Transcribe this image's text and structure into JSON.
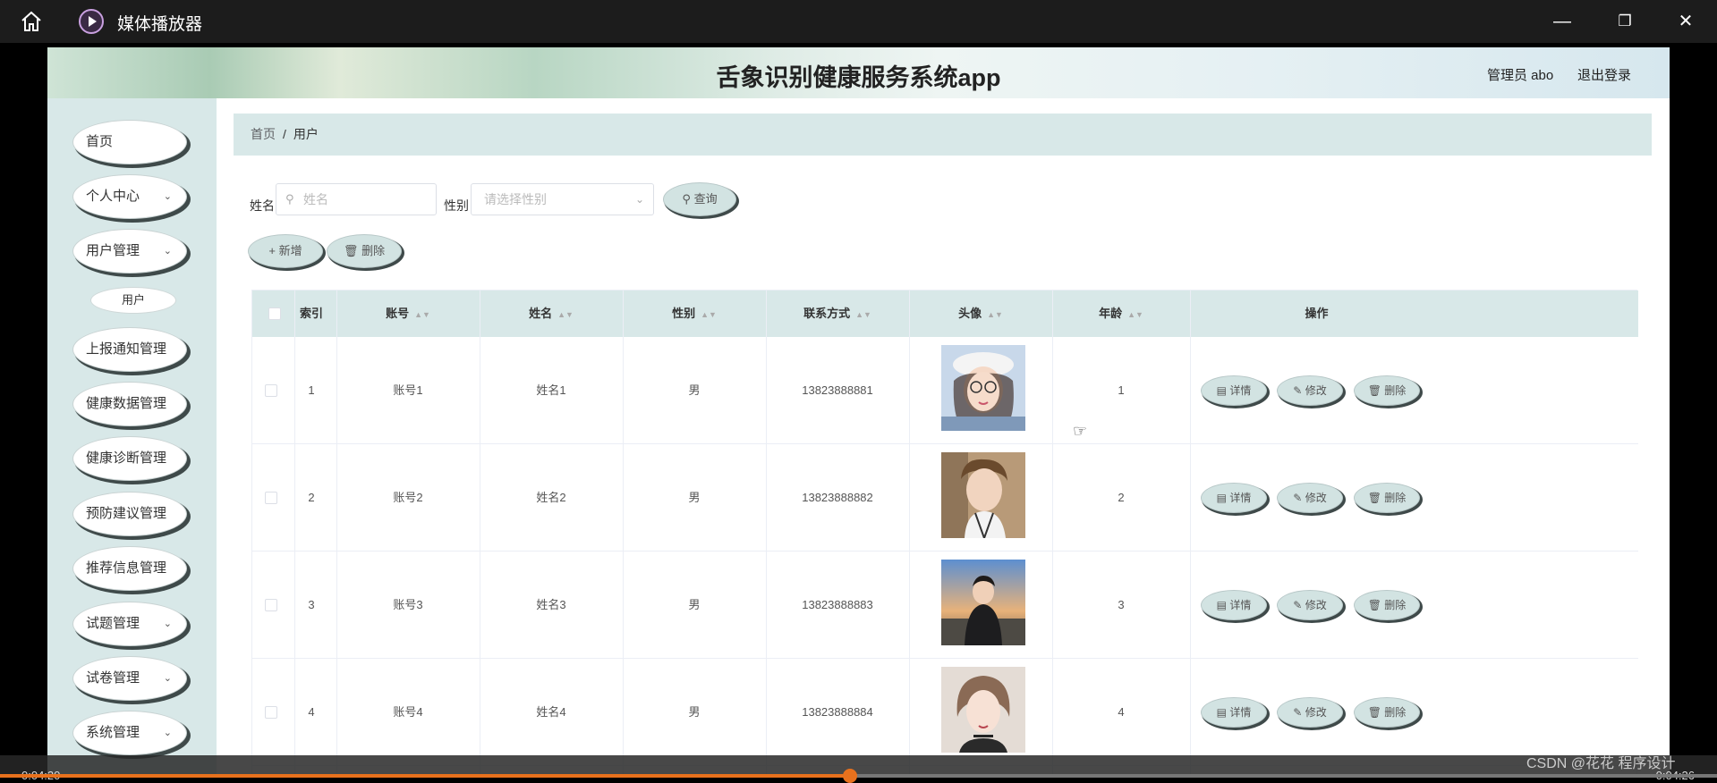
{
  "player": {
    "app_title": "媒体播放器",
    "time_elapsed": "0:04:20",
    "time_remaining": "0:04:26",
    "progress_fraction": 0.495,
    "accent_color": "#e8711d",
    "watermark": "CSDN @花花 程序设计"
  },
  "site": {
    "title": "舌象识别健康服务系统app",
    "admin_label": "管理员 abo",
    "logout_label": "退出登录"
  },
  "sidebar": {
    "items": [
      {
        "label": "首页",
        "has_submenu": false
      },
      {
        "label": "个人中心",
        "has_submenu": true
      },
      {
        "label": "用户管理",
        "has_submenu": true
      },
      {
        "label": "用户",
        "is_sub": true
      },
      {
        "label": "上报通知管理",
        "has_submenu": false
      },
      {
        "label": "健康数据管理",
        "has_submenu": false
      },
      {
        "label": "健康诊断管理",
        "has_submenu": false
      },
      {
        "label": "预防建议管理",
        "has_submenu": false
      },
      {
        "label": "推荐信息管理",
        "has_submenu": false
      },
      {
        "label": "试题管理",
        "has_submenu": true
      },
      {
        "label": "试卷管理",
        "has_submenu": true
      },
      {
        "label": "系统管理",
        "has_submenu": true
      }
    ]
  },
  "breadcrumb": {
    "home": "首页",
    "separator": "/",
    "current": "用户"
  },
  "search": {
    "name_label": "姓名",
    "name_placeholder": "姓名",
    "gender_label": "性别",
    "gender_placeholder": "请选择性别",
    "query_button": "查询"
  },
  "actions": {
    "add_button": "新增",
    "delete_button": "删除"
  },
  "table": {
    "columns": [
      "索引",
      "账号",
      "姓名",
      "性别",
      "联系方式",
      "头像",
      "年龄",
      "操作"
    ],
    "rows": [
      {
        "index": "1",
        "account": "账号1",
        "name": "姓名1",
        "gender": "男",
        "phone": "13823888881",
        "age": "1"
      },
      {
        "index": "2",
        "account": "账号2",
        "name": "姓名2",
        "gender": "男",
        "phone": "13823888882",
        "age": "2"
      },
      {
        "index": "3",
        "account": "账号3",
        "name": "姓名3",
        "gender": "男",
        "phone": "13823888883",
        "age": "3"
      },
      {
        "index": "4",
        "account": "账号4",
        "name": "姓名4",
        "gender": "男",
        "phone": "13823888884",
        "age": "4"
      }
    ],
    "row_actions": {
      "detail": "详情",
      "edit": "修改",
      "delete": "删除"
    }
  }
}
